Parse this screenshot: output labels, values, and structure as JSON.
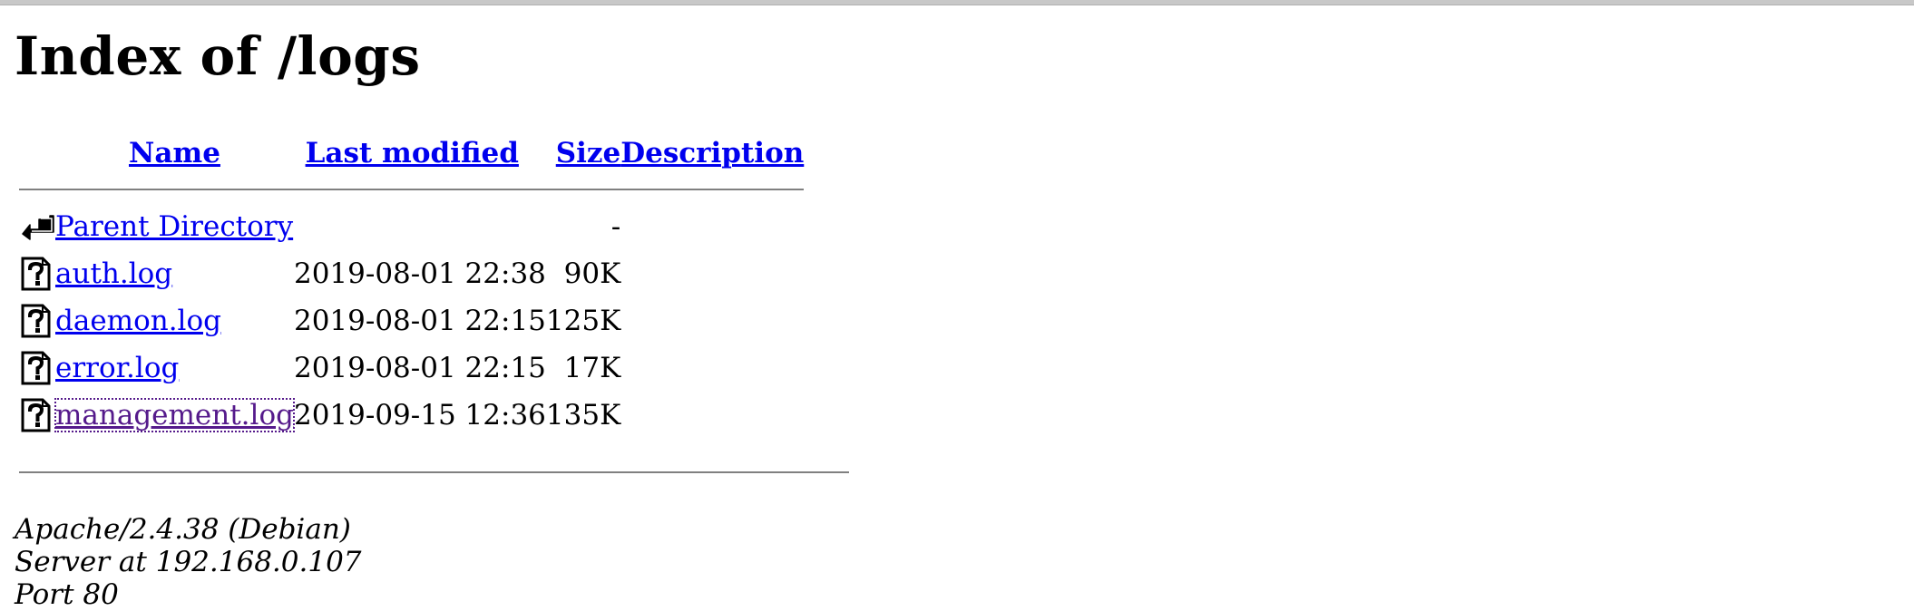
{
  "page": {
    "title": "Index of /logs"
  },
  "columns": {
    "name": "Name",
    "last_modified": "Last modified",
    "size": "Size",
    "description": "Description"
  },
  "parent": {
    "label": "Parent Directory",
    "size": "-",
    "icon": "back-icon"
  },
  "rows": [
    {
      "name": "auth.log",
      "modified": "2019-08-01 22:38",
      "size": "90K",
      "icon": "unknown-file-icon"
    },
    {
      "name": "daemon.log",
      "modified": "2019-08-01 22:15",
      "size": "125K",
      "icon": "unknown-file-icon"
    },
    {
      "name": "error.log",
      "modified": "2019-08-01 22:15",
      "size": "17K",
      "icon": "unknown-file-icon"
    },
    {
      "name": "management.log",
      "modified": "2019-09-15 12:36",
      "size": "135K",
      "icon": "unknown-file-icon",
      "visited": true
    }
  ],
  "footer": {
    "text": "Apache/2.4.38 (Debian) Server at 192.168.0.107 Port 80"
  },
  "colors": {
    "link": "#0000ee",
    "visited_link": "#551a8b",
    "rule": "#808080"
  }
}
